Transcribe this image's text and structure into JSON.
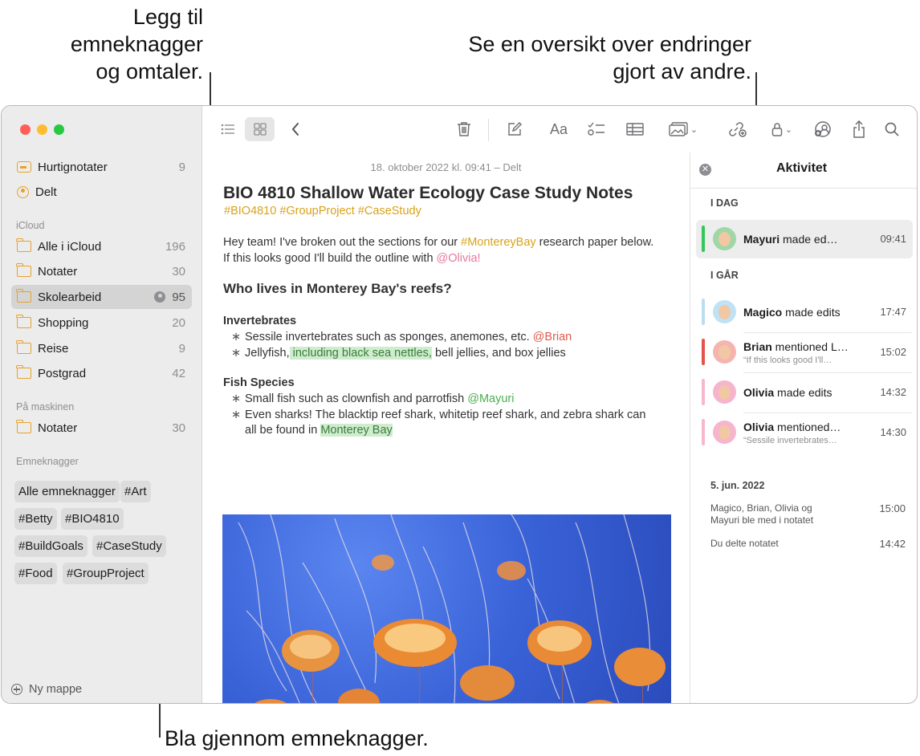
{
  "callouts": {
    "tags_mentions": [
      "Legg til",
      "emneknagger",
      "og omtaler."
    ],
    "activity": [
      "Se en oversikt over endringer",
      "gjort av andre."
    ],
    "browse_tags": "Bla gjennom emneknagger."
  },
  "sidebar": {
    "top_items": [
      {
        "label": "Hurtignotater",
        "count": "9",
        "icon": "quick-note-icon"
      },
      {
        "label": "Delt",
        "count": "",
        "icon": "shared-icon"
      }
    ],
    "icloud_label": "iCloud",
    "icloud_items": [
      {
        "label": "Alle i iCloud",
        "count": "196"
      },
      {
        "label": "Notater",
        "count": "30"
      },
      {
        "label": "Skolearbeid",
        "count": "95"
      },
      {
        "label": "Shopping",
        "count": "20"
      },
      {
        "label": "Reise",
        "count": "9"
      },
      {
        "label": "Postgrad",
        "count": "42"
      }
    ],
    "mac_label": "På maskinen",
    "mac_items": [
      {
        "label": "Notater",
        "count": "30"
      }
    ],
    "tags_label": "Emneknagger",
    "tags": [
      "Alle emneknagger",
      "#Art",
      "#Betty",
      "#BIO4810",
      "#BuildGoals",
      "#CaseStudy",
      "#Food",
      "#GroupProject"
    ],
    "new_folder": "Ny mappe"
  },
  "toolbar": {
    "icons": [
      "list-view-icon",
      "gallery-view-icon",
      "back-icon",
      "trash-icon",
      "compose-icon",
      "format-icon",
      "checklist-icon",
      "table-icon",
      "media-icon",
      "collaborate-icon",
      "lock-icon",
      "activity-icon",
      "share-icon",
      "search-icon"
    ],
    "format_label": "Aa"
  },
  "note": {
    "date": "18. oktober 2022 kl. 09:41 – Delt",
    "title": "BIO 4810 Shallow Water Ecology Case Study Notes",
    "tags": "#BIO4810 #GroupProject #CaseStudy",
    "intro": {
      "part1": "Hey team! I've broken out the sections for our ",
      "tag": "#MontereyBay",
      "part2": " research paper below. If this looks good I'll build the outline with ",
      "mention": "@Olivia!"
    },
    "heading": "Who lives in Monterey Bay's reefs?",
    "sec1_title": "Invertebrates",
    "sec1_b1_text": "Sessile invertebrates such as sponges, anemones, etc. ",
    "sec1_b1_mention": "@Brian",
    "sec1_b2_pre": "Jellyfish,",
    "sec1_b2_hl": " including black sea nettles,",
    "sec1_b2_post": " bell jellies, and box jellies",
    "sec2_title": "Fish Species",
    "sec2_b1_text": "Small fish such as clownfish and parrotfish ",
    "sec2_b1_mention": "@Mayuri",
    "sec2_b2_text": "Even sharks! The blacktip reef shark, whitetip reef shark, and zebra shark can all be found in ",
    "sec2_b2_hl": "Monterey Bay"
  },
  "activity": {
    "title": "Aktivitet",
    "today_label": "I DAG",
    "yesterday_label": "I GÅR",
    "rows": [
      {
        "name": "Mayuri",
        "action": " made ed…",
        "sub": "",
        "time": "09:41",
        "bar": "#34c759"
      },
      {
        "name": "Magico",
        "action": " made edits",
        "sub": "",
        "time": "17:47",
        "bar": "#b9def0"
      },
      {
        "name": "Brian",
        "action": " mentioned L…",
        "sub": "“If this looks good I'll…",
        "time": "15:02",
        "bar": "#e5534b"
      },
      {
        "name": "Olivia",
        "action": " made edits",
        "sub": "",
        "time": "14:32",
        "bar": "#f7b7cd"
      },
      {
        "name": "Olivia",
        "action": " mentioned…",
        "sub": "“Sessile invertebrates…",
        "time": "14:30",
        "bar": "#f7b7cd"
      }
    ],
    "history_label": "5. jun. 2022",
    "history": [
      {
        "text1": "Magico, Brian, Olivia og",
        "text2": "Mayuri ble med i notatet",
        "time": "15:00"
      },
      {
        "text1": "Du delte notatet",
        "text2": "",
        "time": "14:42"
      }
    ]
  },
  "colors": {
    "accent": "#e6a22c",
    "tag": "#d8a21b",
    "close": "#ff5f57",
    "minimize": "#febc2e",
    "zoom": "#28c840"
  }
}
